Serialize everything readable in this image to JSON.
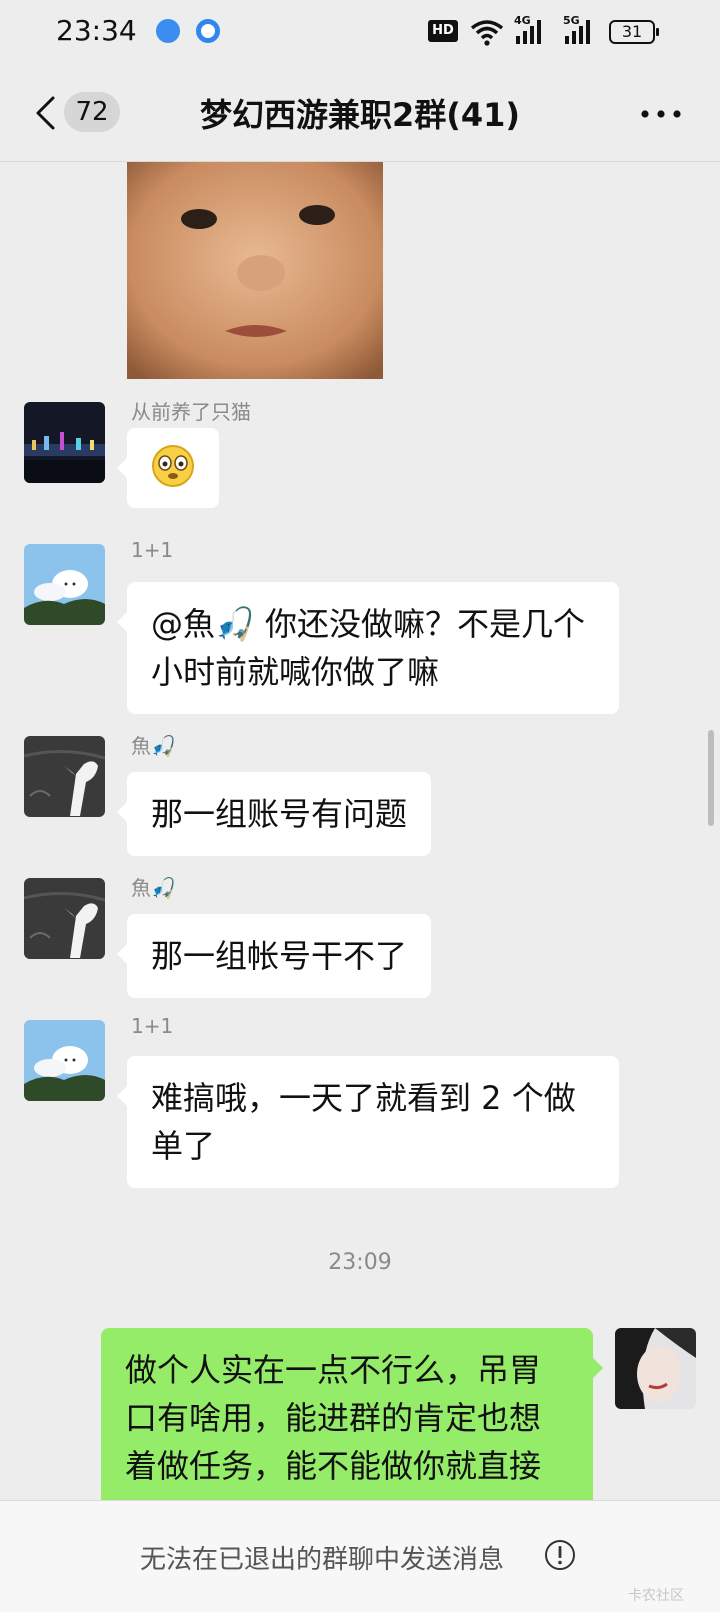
{
  "status_bar": {
    "time": "23:34",
    "hd_label": "HD",
    "net1_label": "4G",
    "net2_label": "5G",
    "battery": "31",
    "icons": [
      "app-icon-1",
      "app-icon-2",
      "hd-voice-icon",
      "wifi-icon",
      "signal-4g-icon",
      "signal-5g-icon",
      "battery-icon"
    ]
  },
  "header": {
    "unread_count": "72",
    "title": "梦幻西游兼职2群(41)",
    "icons": [
      "back-icon",
      "more-icon"
    ]
  },
  "messages": [
    {
      "type": "image",
      "description_icon": "sticker-photo"
    },
    {
      "sender": "从前养了只猫",
      "content_emoji": "😳"
    },
    {
      "sender": "1+1",
      "text": "@魚🎣 你还没做嘛？不是几个小时前就喊你做了嘛"
    },
    {
      "sender": "魚🎣",
      "text": "那一组账号有问题"
    },
    {
      "sender": "魚🎣",
      "text": "那一组帐号干不了"
    },
    {
      "sender": "1+1",
      "text": "难搞哦，一天了就看到 2 个做单了"
    }
  ],
  "time_separator": "23:09",
  "my_message": {
    "text": "做个人实在一点不行么，吊胃口有啥用，能进群的肯定也想着做任务，能不能做你就直接"
  },
  "bottom_bar": {
    "notice": "无法在已退出的群聊中发送消息",
    "icon": "exclamation-icon",
    "watermark": "卡农社区"
  },
  "colors": {
    "background": "#ededed",
    "bubble_other": "#ffffff",
    "bubble_mine": "#95ec69",
    "sender_name": "#8a8a8a"
  }
}
